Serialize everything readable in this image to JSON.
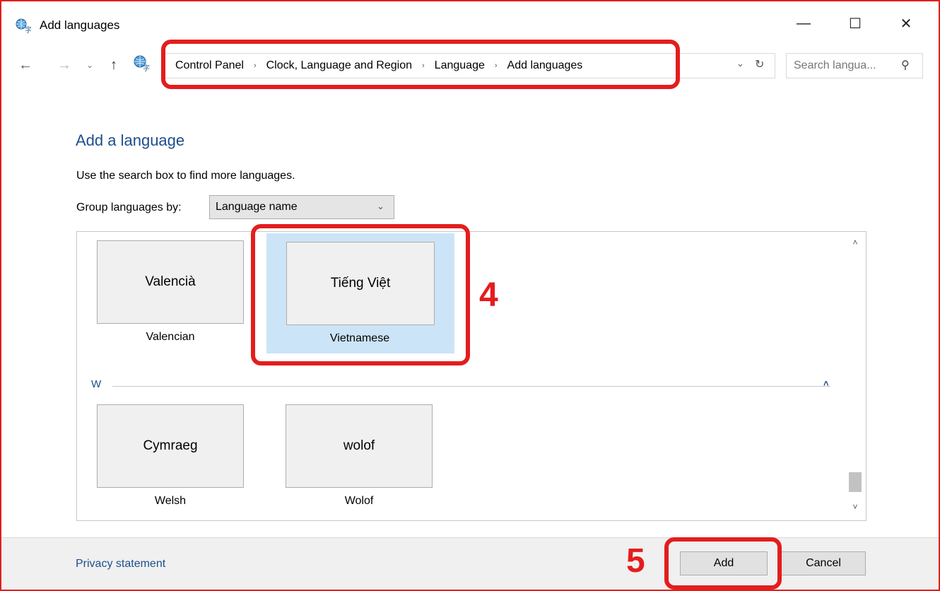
{
  "window": {
    "title": "Add languages",
    "minimize_icon": "—",
    "maximize_icon": "☐",
    "close_icon": "✕"
  },
  "nav": {
    "back_icon": "←",
    "forward_icon": "→",
    "recent_icon": "⌄",
    "up_icon": "↑"
  },
  "breadcrumb": {
    "items": [
      "Control Panel",
      "Clock, Language and Region",
      "Language",
      "Add languages"
    ],
    "separator": "›",
    "dropdown_icon": "⌄",
    "refresh_icon": "↻"
  },
  "search": {
    "placeholder": "Search langua...",
    "icon": "⚲"
  },
  "content": {
    "heading": "Add a language",
    "description": "Use the search box to find more languages.",
    "group_by_label": "Group languages by:",
    "group_by_value": "Language name",
    "group_by_arrow": "⌄"
  },
  "languages": {
    "row1": [
      {
        "native": "Valencià",
        "english": "Valencian",
        "selected": false
      },
      {
        "native": "Tiếng Việt",
        "english": "Vietnamese",
        "selected": true
      }
    ],
    "group_w": {
      "letter": "W",
      "collapse_icon": "˄"
    },
    "row2": [
      {
        "native": "Cymraeg",
        "english": "Welsh",
        "selected": false
      },
      {
        "native": "wolof",
        "english": "Wolof",
        "selected": false
      }
    ],
    "scroll_up_icon": "˄",
    "scroll_down_icon": "˅"
  },
  "footer": {
    "privacy_link": "Privacy statement",
    "add_button": "Add",
    "cancel_button": "Cancel"
  },
  "annotations": {
    "step4": "4",
    "step5": "5",
    "color": "#e41d1d"
  }
}
